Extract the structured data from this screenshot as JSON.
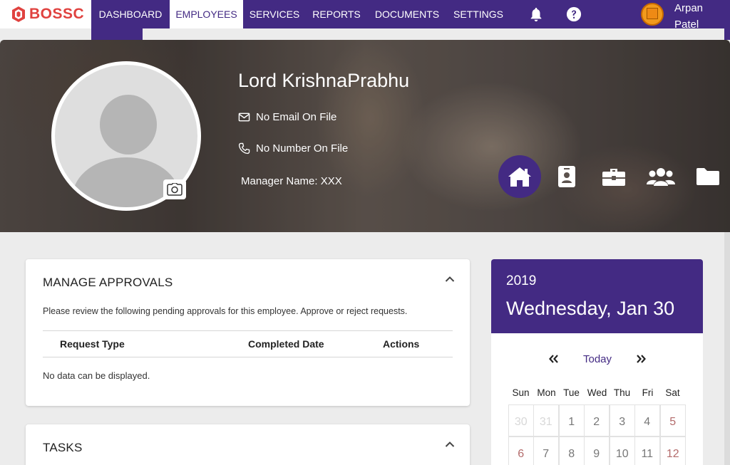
{
  "brand": {
    "logo_text": "BOSSC",
    "accent": "#432a83",
    "logo_color": "#e0423f"
  },
  "nav": {
    "items": [
      {
        "label": "DASHBOARD"
      },
      {
        "label": "EMPLOYEES"
      },
      {
        "label": "SERVICES"
      },
      {
        "label": "REPORTS"
      },
      {
        "label": "DOCUMENTS"
      },
      {
        "label": "SETTINGS"
      }
    ],
    "icons": [
      "bell-icon",
      "help-icon"
    ],
    "user": {
      "first": "Arpan",
      "last": "Patel"
    }
  },
  "profile": {
    "name": "Lord KrishnaPrabhu",
    "email": "No Email On File",
    "phone": "No Number On File",
    "manager": "Manager Name: XXX",
    "tabs": [
      "home-icon",
      "id-badge-icon",
      "briefcase-icon",
      "users-icon",
      "folder-icon"
    ]
  },
  "approvals": {
    "title": "MANAGE APPROVALS",
    "description": "Please review the following pending approvals for this employee. Approve or reject requests.",
    "columns": [
      "Request Type",
      "Completed Date",
      "Actions"
    ],
    "empty": "No data can be displayed."
  },
  "tasks": {
    "title": "TASKS"
  },
  "calendar": {
    "year": "2019",
    "date": "Wednesday, Jan 30",
    "today": "Today",
    "weekdays": [
      "Sun",
      "Mon",
      "Tue",
      "Wed",
      "Thu",
      "Fri",
      "Sat"
    ],
    "week1": [
      "30",
      "31",
      "1",
      "2",
      "3",
      "4",
      "5"
    ],
    "week2": [
      "6",
      "7",
      "8",
      "9",
      "10",
      "11",
      "12"
    ]
  }
}
